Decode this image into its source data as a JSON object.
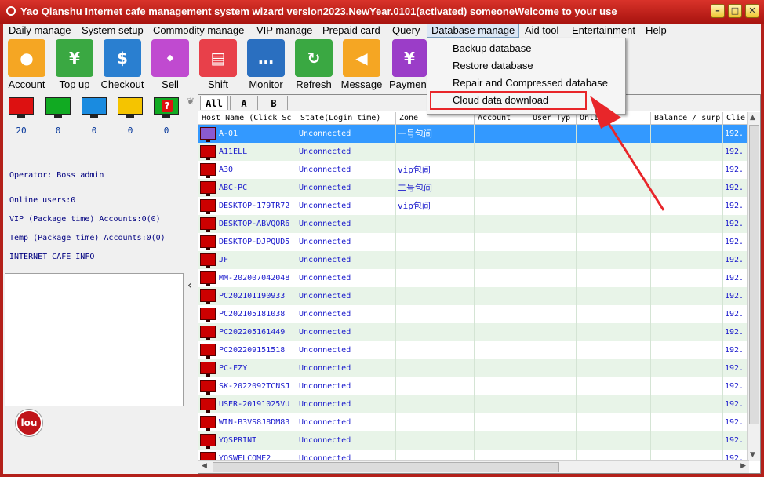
{
  "window": {
    "title": "Yao Qianshu Internet cafe management system wizard version2023.NewYear.0101(activated)  someoneWelcome to your use"
  },
  "menu": [
    {
      "label": "Daily manage"
    },
    {
      "label": "System setup"
    },
    {
      "label": "Commodity manage"
    },
    {
      "label": "VIP manage"
    },
    {
      "label": "Prepaid card"
    },
    {
      "label": "Query"
    },
    {
      "label": "Database manage"
    },
    {
      "label": "Aid tool"
    },
    {
      "label": "Entertainment"
    },
    {
      "label": "Help"
    }
  ],
  "toolbar": [
    {
      "label": "Account",
      "icon": "person-icon",
      "color": "#f5a623"
    },
    {
      "label": "Top up",
      "icon": "money-bag-icon",
      "color": "#3aa842"
    },
    {
      "label": "Checkout",
      "icon": "dollar-bill-icon",
      "color": "#2a7fd0"
    },
    {
      "label": "Sell",
      "icon": "sale-tag-icon",
      "color": "#c04ad0"
    },
    {
      "label": "Shift",
      "icon": "shift-icon",
      "color": "#e8404a"
    },
    {
      "label": "Monitor",
      "icon": "chat-monitor-icon",
      "color": "#2a6fc0"
    },
    {
      "label": "Refresh",
      "icon": "refresh-icon",
      "color": "#3aa842"
    },
    {
      "label": "Message",
      "icon": "megaphone-icon",
      "color": "#f5a623"
    },
    {
      "label": "Paymen",
      "icon": "yen-icon",
      "color": "#9b3dc8"
    }
  ],
  "status_monitors": [
    {
      "color": "#dd1111",
      "count": "20"
    },
    {
      "color": "#11aa22",
      "count": "0"
    },
    {
      "color": "#1a8be0",
      "count": "0"
    },
    {
      "color": "#f5c400",
      "count": "0"
    },
    {
      "color": "#11aa22",
      "count": "0",
      "glyph": "?"
    }
  ],
  "info": {
    "operator": "Operator: Boss admin",
    "online_users": "Online users:0",
    "vip_accounts": "VIP (Package time) Accounts:0(0)",
    "temp_accounts": "Temp (Package time) Accounts:0(0)",
    "cafe_info": "INTERNET CAFE  INFO"
  },
  "logo_text": "lou",
  "tabs": [
    {
      "label": "All"
    },
    {
      "label": "A"
    },
    {
      "label": "B"
    }
  ],
  "columns": [
    "Host Name (Click Sc",
    "State(Login time)",
    "Zone",
    "Account",
    "User Typ",
    "Onli",
    "Balance / surp",
    "Clie"
  ],
  "rows": [
    {
      "host": "A-01",
      "state": "Unconnected",
      "zone": "一号包间",
      "client": "192."
    },
    {
      "host": "A11ELL",
      "state": "Unconnected",
      "zone": "",
      "client": "192."
    },
    {
      "host": "A30",
      "state": "Unconnected",
      "zone": "vip包间",
      "client": "192."
    },
    {
      "host": "ABC-PC",
      "state": "Unconnected",
      "zone": "二号包间",
      "client": "192."
    },
    {
      "host": "DESKTOP-179TR72",
      "state": "Unconnected",
      "zone": "vip包间",
      "client": "192."
    },
    {
      "host": "DESKTOP-ABVQOR6",
      "state": "Unconnected",
      "zone": "",
      "client": "192."
    },
    {
      "host": "DESKTOP-DJPQUD5",
      "state": "Unconnected",
      "zone": "",
      "client": "192."
    },
    {
      "host": "JF",
      "state": "Unconnected",
      "zone": "",
      "client": "192."
    },
    {
      "host": "MM-202007042048",
      "state": "Unconnected",
      "zone": "",
      "client": "192."
    },
    {
      "host": "PC202101190933",
      "state": "Unconnected",
      "zone": "",
      "client": "192."
    },
    {
      "host": "PC202105181038",
      "state": "Unconnected",
      "zone": "",
      "client": "192."
    },
    {
      "host": "PC202205161449",
      "state": "Unconnected",
      "zone": "",
      "client": "192."
    },
    {
      "host": "PC202209151518",
      "state": "Unconnected",
      "zone": "",
      "client": "192."
    },
    {
      "host": "PC-FZY",
      "state": "Unconnected",
      "zone": "",
      "client": "192."
    },
    {
      "host": "SK-2022092TCNSJ",
      "state": "Unconnected",
      "zone": "",
      "client": "192."
    },
    {
      "host": "USER-20191025VU",
      "state": "Unconnected",
      "zone": "",
      "client": "192."
    },
    {
      "host": "WIN-B3VS8J8DM83",
      "state": "Unconnected",
      "zone": "",
      "client": "192."
    },
    {
      "host": "YQSPRINT",
      "state": "Unconnected",
      "zone": "",
      "client": "192."
    },
    {
      "host": "YQSWELCOME2",
      "state": "Unconnected",
      "zone": "",
      "client": "192."
    }
  ],
  "dropdown": [
    {
      "label": "Backup database"
    },
    {
      "label": "Restore database"
    },
    {
      "label": "Repair and Compressed database"
    },
    {
      "label": "Cloud data download"
    }
  ],
  "colors": {
    "title_bar": "#b3201a",
    "selected_row": "#3399ff",
    "alt_row": "#e8f4e8",
    "highlight": "#e8262a"
  }
}
